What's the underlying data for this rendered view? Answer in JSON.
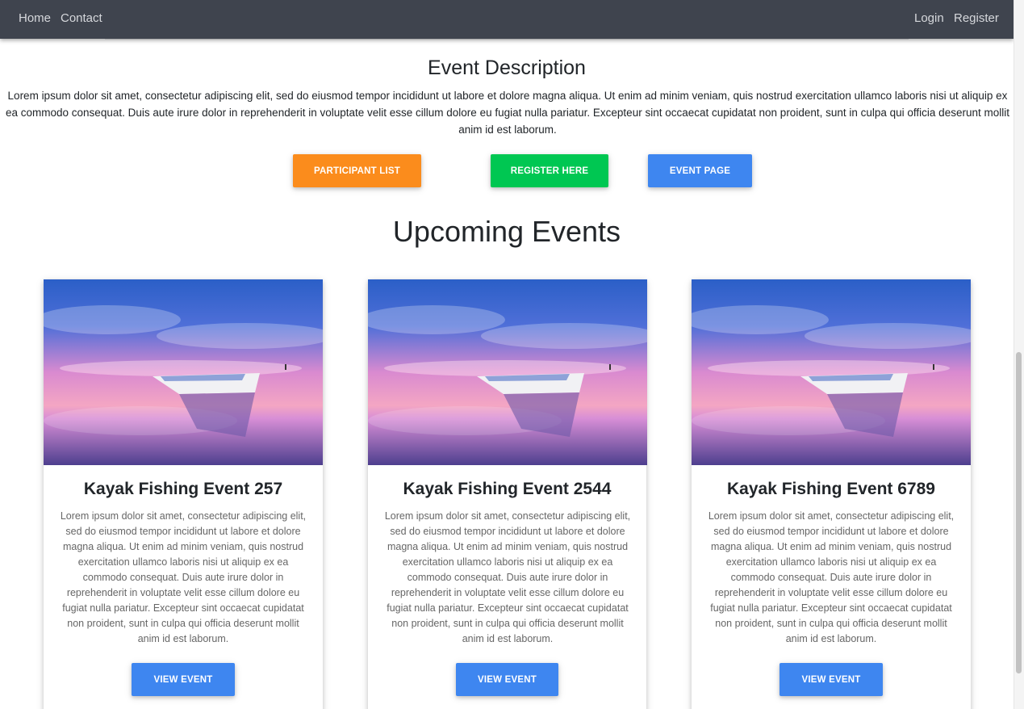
{
  "nav": {
    "left": [
      "Home",
      "Contact"
    ],
    "right": [
      "Login",
      "Register"
    ]
  },
  "event_description": {
    "title": "Event Description",
    "text": "Lorem ipsum dolor sit amet, consectetur adipiscing elit, sed do eiusmod tempor incididunt ut labore et dolore magna aliqua. Ut enim ad minim veniam, quis nostrud exercitation ullamco laboris nisi ut aliquip ex ea commodo consequat. Duis aute irure dolor in reprehenderit in voluptate velit esse cillum dolore eu fugiat nulla pariatur. Excepteur sint occaecat cupidatat non proident, sunt in culpa qui officia deserunt mollit anim id est laborum.",
    "buttons": [
      {
        "label": "PARTICIPANT LIST",
        "color": "#fb8c1c"
      },
      {
        "label": "REGISTER HERE",
        "color": "#00c752"
      },
      {
        "label": "EVENT PAGE",
        "color": "#3e86f0"
      }
    ]
  },
  "upcoming": {
    "title": "Upcoming Events",
    "cards": [
      {
        "title": "Kayak Fishing Event 257",
        "text": "Lorem ipsum dolor sit amet, consectetur adipiscing elit, sed do eiusmod tempor incididunt ut labore et dolore magna aliqua. Ut enim ad minim veniam, quis nostrud exercitation ullamco laboris nisi ut aliquip ex ea commodo consequat. Duis aute irure dolor in reprehenderit in voluptate velit esse cillum dolore eu fugiat nulla pariatur. Excepteur sint occaecat cupidatat non proident, sunt in culpa qui officia deserunt mollit anim id est laborum.",
        "button": "VIEW EVENT"
      },
      {
        "title": "Kayak Fishing Event 2544",
        "text": "Lorem ipsum dolor sit amet, consectetur adipiscing elit, sed do eiusmod tempor incididunt ut labore et dolore magna aliqua. Ut enim ad minim veniam, quis nostrud exercitation ullamco laboris nisi ut aliquip ex ea commodo consequat. Duis aute irure dolor in reprehenderit in voluptate velit esse cillum dolore eu fugiat nulla pariatur. Excepteur sint occaecat cupidatat non proident, sunt in culpa qui officia deserunt mollit anim id est laborum.",
        "button": "VIEW EVENT"
      },
      {
        "title": "Kayak Fishing Event 6789",
        "text": "Lorem ipsum dolor sit amet, consectetur adipiscing elit, sed do eiusmod tempor incididunt ut labore et dolore magna aliqua. Ut enim ad minim veniam, quis nostrud exercitation ullamco laboris nisi ut aliquip ex ea commodo consequat. Duis aute irure dolor in reprehenderit in voluptate velit esse cillum dolore eu fugiat nulla pariatur. Excepteur sint occaecat cupidatat non proident, sunt in culpa qui officia deserunt mollit anim id est laborum.",
        "button": "VIEW EVENT"
      }
    ]
  },
  "colors": {
    "navbar": "#3f444e",
    "primary": "#3e86f0",
    "orange": "#fb8c1c",
    "green": "#00c752"
  }
}
